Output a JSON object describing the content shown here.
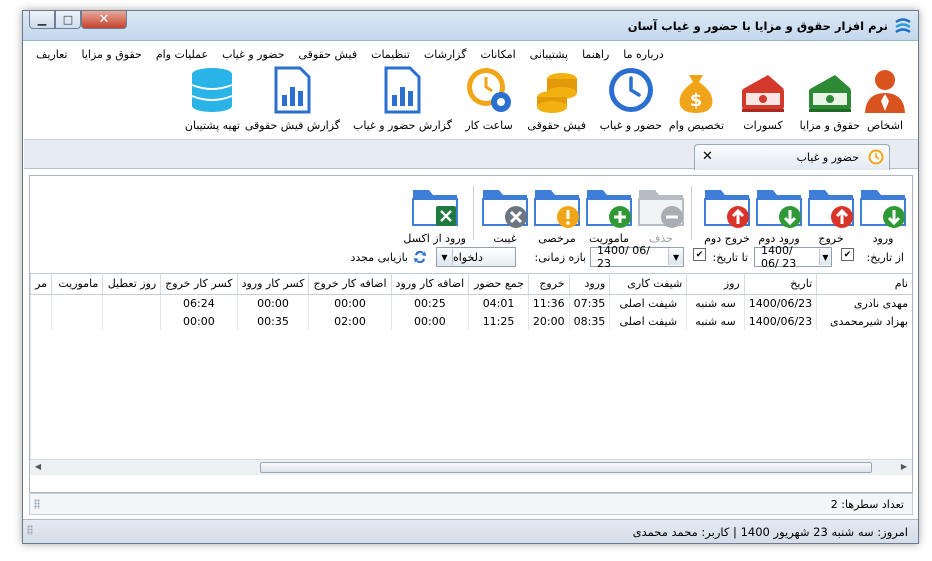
{
  "window": {
    "title": "نرم افزار حقوق و مزایا با حضور و غیاب آسان"
  },
  "menu": [
    "تعاریف",
    "حقوق و مزایا",
    "عملیات وام",
    "حضور و غیاب",
    "فیش حقوقی",
    "تنظیمات",
    "گزارشات",
    "امکانات",
    "پشتیبانی",
    "راهنما",
    "درباره ما"
  ],
  "ribbon": [
    {
      "label": "اشخاص",
      "icon": "person-icon"
    },
    {
      "label": "حقوق و مزایا",
      "icon": "money-stack-icon"
    },
    {
      "label": "کسورات",
      "icon": "money-deduction-icon"
    },
    {
      "label": "تخصیص وام",
      "icon": "money-bag-icon"
    },
    {
      "label": "حضور و غیاب",
      "icon": "clock-icon"
    },
    {
      "label": "فیش حقوقی",
      "icon": "coins-icon"
    },
    {
      "label": "ساعت کار",
      "icon": "clock-gear-icon"
    },
    {
      "label": "گزارش حضور و غیاب",
      "icon": "report-chart-icon"
    },
    {
      "label": "گزارش فیش حقوقی",
      "icon": "report-chart-icon"
    },
    {
      "label": "تهیه پشتیبان",
      "icon": "database-icon"
    }
  ],
  "doc_tab": {
    "label": "حضور و غیاب"
  },
  "toolbar": [
    {
      "label": "ورود",
      "icon": "folder-down-green-icon"
    },
    {
      "label": "خروج",
      "icon": "folder-up-red-icon"
    },
    {
      "label": "ورود دوم",
      "icon": "folder-down-green-icon"
    },
    {
      "label": "خروج دوم",
      "icon": "folder-up-red-icon"
    },
    {
      "label": "حذف",
      "icon": "folder-minus-icon",
      "disabled": true
    },
    {
      "label": "ماموریت",
      "icon": "folder-plus-icon"
    },
    {
      "label": "مرخصی",
      "icon": "folder-exclamation-icon"
    },
    {
      "label": "غیبت",
      "icon": "folder-x-icon"
    },
    {
      "label": "ورود از اکسل",
      "icon": "folder-excel-icon"
    }
  ],
  "filters": {
    "from_label": "از تاریخ:",
    "from_value": "1400/ 06/ 23",
    "to_label": "تا تاریخ:",
    "to_value": "1400/ 06/ 23",
    "range_label": "بازه زمانی:",
    "range_value": "دلخواه",
    "refresh_label": "بازیابی مجدد"
  },
  "table": {
    "columns": [
      "نام",
      "تاریخ",
      "روز",
      "شیفت کاری",
      "ورود",
      "خروج",
      "جمع حضور",
      "اضافه کار ورود",
      "اضافه کار خروج",
      "کسر کار ورود",
      "کسر کار خروج",
      "روز تعطیل",
      "ماموریت",
      "مر"
    ],
    "rows": [
      [
        "مهدی نادری",
        "1400/06/23",
        "سه شنبه",
        "شیفت اصلی",
        "07:35",
        "11:36",
        "04:01",
        "00:25",
        "00:00",
        "00:00",
        "06:24",
        "",
        "",
        ""
      ],
      [
        "بهزاد شیرمحمدی",
        "1400/06/23",
        "سه شنبه",
        "شیفت اصلی",
        "08:35",
        "20:00",
        "11:25",
        "00:00",
        "02:00",
        "00:35",
        "00:00",
        "",
        "",
        ""
      ]
    ]
  },
  "status": {
    "row_count_label": "تعداد سطرها:",
    "row_count": "2"
  },
  "footer": {
    "text": "امروز: سه شنبه 23 شهریور 1400  |  کاربر: محمد محمدی"
  }
}
